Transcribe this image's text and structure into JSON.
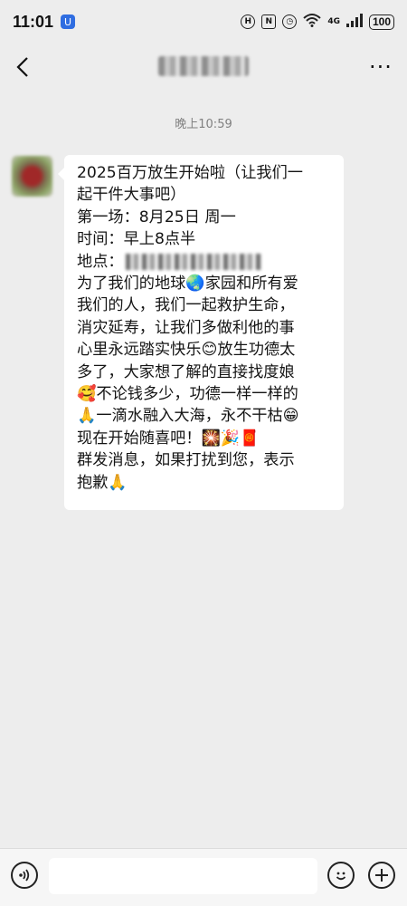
{
  "status_bar": {
    "time": "11:01",
    "app_badge": "U",
    "icons": [
      "hd-icon",
      "nfc-icon",
      "alarm-icon",
      "wifi-icon",
      "signal-icon"
    ],
    "network": "4G",
    "battery": "100"
  },
  "nav": {
    "back_glyph": "‹",
    "more_glyph": "···"
  },
  "chat": {
    "timestamp": "晚上10:59",
    "message_lines": [
      "2025百万放生开始啦（让我们一",
      "起干件大事吧）",
      "第一场：8月25日 周一",
      "时间：早上8点半",
      "地点：",
      "为了我们的地球🌏家园和所有爱",
      "我们的人，我们一起救护生命，",
      "消灾延寿，让我们多做利他的事",
      "心里永远踏实快乐😊放生功德太",
      "多了，大家想了解的直接找度娘",
      "🥰不论钱多少，功德一样一样的",
      "🙏一滴水融入大海，永不干枯😁",
      "现在开始随喜吧！🎇🎉🧧",
      "群发消息，如果打扰到您，表示",
      "抱歉🙏"
    ]
  },
  "input_bar": {
    "voice_glyph": "◁))",
    "emoji_glyph": "☺",
    "plus_glyph": "+",
    "input_value": ""
  }
}
